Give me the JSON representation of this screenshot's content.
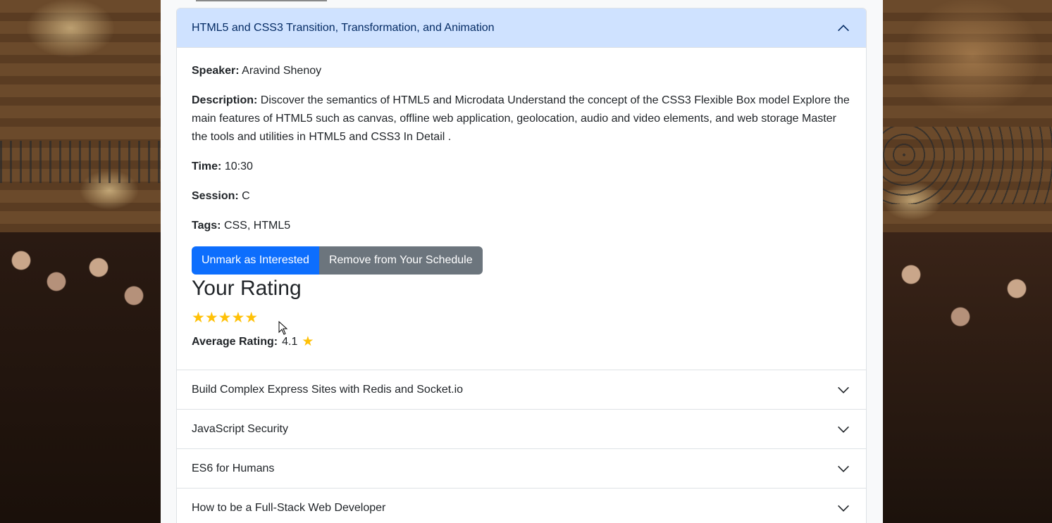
{
  "sessions": [
    {
      "title": "HTML5 and CSS3 Transition, Transformation, and Animation",
      "expanded": true,
      "speaker_label": "Speaker:",
      "speaker": "Aravind Shenoy",
      "description_label": "Description:",
      "description": "Discover the semantics of HTML5 and Microdata Understand the concept of the CSS3 Flexible Box model Explore the main features of HTML5 such as canvas, offline web application, geolocation, audio and video elements, and web storage Master the tools and utilities in HTML5 and CSS3 In Detail .",
      "time_label": "Time:",
      "time": "10:30",
      "session_label": "Session:",
      "session": "C",
      "tags_label": "Tags:",
      "tags": "CSS, HTML5",
      "interest_button": "Unmark as Interested",
      "schedule_button": "Remove from Your Schedule",
      "rating_title": "Your Rating",
      "your_rating": 5,
      "stars_text": "★★★★★",
      "avg_label": "Average Rating:",
      "avg_rating": "4.1"
    },
    {
      "title": "Build Complex Express Sites with Redis and Socket.io",
      "expanded": false
    },
    {
      "title": "JavaScript Security",
      "expanded": false
    },
    {
      "title": "ES6 for Humans",
      "expanded": false
    },
    {
      "title": "How to be a Full-Stack Web Developer",
      "expanded": false
    }
  ],
  "colors": {
    "header_open_bg": "#cfe2ff",
    "primary": "#0d6efd",
    "secondary": "#6c757d",
    "star": "#ffc107"
  }
}
